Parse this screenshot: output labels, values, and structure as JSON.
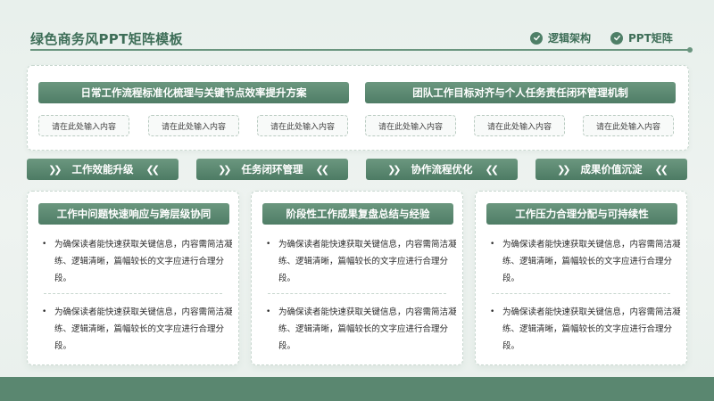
{
  "header": {
    "title": "绿色商务风PPT矩阵模板",
    "nav": [
      {
        "label": "逻辑架构",
        "icon": "check-circle-icon"
      },
      {
        "label": "PPT矩阵",
        "icon": "check-circle-icon"
      }
    ]
  },
  "top_section": {
    "groups": [
      {
        "title": "日常工作流程标准化梳理与关键节点效率提升方案",
        "inputs": [
          "请在此处输入内容",
          "请在此处输入内容",
          "请在此处输入内容"
        ]
      },
      {
        "title": "团队工作目标对齐与个人任务责任闭环管理机制",
        "inputs": [
          "请在此处输入内容",
          "请在此处输入内容",
          "请在此处输入内容"
        ]
      }
    ]
  },
  "tabs": [
    {
      "label": "工作效能升级"
    },
    {
      "label": "任务闭环管理"
    },
    {
      "label": "协作流程优化"
    },
    {
      "label": "成果价值沉淀"
    }
  ],
  "chevrons": {
    "right": "❯❯",
    "left": "❮❮"
  },
  "bullet_symbol": "•",
  "cards": [
    {
      "title": "工作中问题快速响应与跨层级协同",
      "bullets": [
        "为确保读者能快速获取关键信息，内容需简洁凝练、逻辑清晰，篇幅较长的文字应进行合理分段。",
        "为确保读者能快速获取关键信息，内容需简洁凝练、逻辑清晰，篇幅较长的文字应进行合理分段。"
      ]
    },
    {
      "title": "阶段性工作成果复盘总结与经验",
      "bullets": [
        "为确保读者能快速获取关键信息，内容需简洁凝练、逻辑清晰，篇幅较长的文字应进行合理分段。",
        "为确保读者能快速获取关键信息，内容需简洁凝练、逻辑清晰，篇幅较长的文字应进行合理分段。"
      ]
    },
    {
      "title": "工作压力合理分配与可持续性",
      "bullets": [
        "为确保读者能快速获取关键信息，内容需简洁凝练、逻辑清晰，篇幅较长的文字应进行合理分段。",
        "为确保读者能快速获取关键信息，内容需简洁凝练、逻辑清晰，篇幅较长的文字应进行合理分段。"
      ]
    }
  ],
  "colors": {
    "primary": "#4f7d66",
    "primary_light": "#6b977f",
    "background": "#e8f0ec",
    "footer": "#5a8770"
  }
}
